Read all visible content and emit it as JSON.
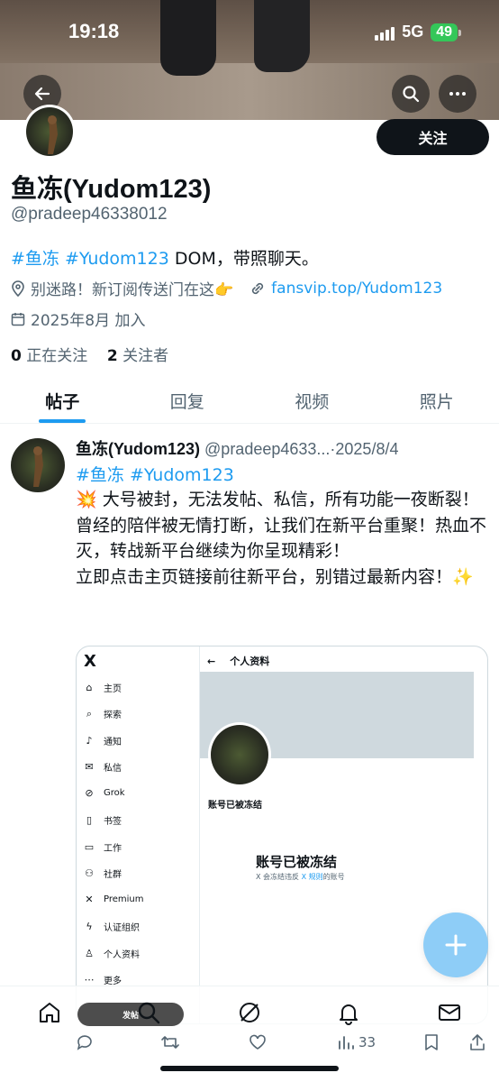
{
  "status": {
    "time": "19:18",
    "network": "5G",
    "battery": "49"
  },
  "profile": {
    "display_name": "鱼冻(Yudom123)",
    "handle": "@pradeep46338012",
    "follow_label": "关注",
    "bio_tag1": "#鱼冻",
    "bio_tag2": "#Yudom123",
    "bio_text": " DOM，带照聊天。",
    "location": "别迷路！新订阅传送门在这👉",
    "website": "fansvip.top/Yudom123",
    "joined": "2025年8月 加入",
    "following_count": "0",
    "following_label": "正在关注",
    "followers_count": "2",
    "followers_label": "关注者"
  },
  "tabs": [
    {
      "label": "帖子"
    },
    {
      "label": "回复"
    },
    {
      "label": "视频"
    },
    {
      "label": "照片"
    }
  ],
  "post": {
    "name": "鱼冻(Yudom123)",
    "meta": " @pradeep4633...·2025/8/4",
    "tags": "#鱼冻 #Yudom123",
    "lines": [
      "💥 大号被封，无法发帖、私信，所有功能一夜断裂！",
      "曾经的陪伴被无情打断，让我们在新平台重聚！热血不灭，转战新平台继续为你呈现精彩！",
      "立即点击主页链接前往新平台，别错过最新内容！✨"
    ],
    "views": "33"
  },
  "card": {
    "logo": "X",
    "topbar_title": "个人资料",
    "nav": [
      {
        "icon": "home-icon",
        "label": "主页"
      },
      {
        "icon": "search-icon",
        "label": "探索"
      },
      {
        "icon": "bell-icon",
        "label": "通知"
      },
      {
        "icon": "mail-icon",
        "label": "私信"
      },
      {
        "icon": "grok-icon",
        "label": "Grok"
      },
      {
        "icon": "bookmark-icon",
        "label": "书签"
      },
      {
        "icon": "briefcase-icon",
        "label": "工作"
      },
      {
        "icon": "people-icon",
        "label": "社群"
      },
      {
        "icon": "x-icon",
        "label": "Premium"
      },
      {
        "icon": "bolt-icon",
        "label": "认证组织"
      },
      {
        "icon": "person-icon",
        "label": "个人资料"
      },
      {
        "icon": "more-icon",
        "label": "更多"
      }
    ],
    "frozen_small": "账号已被冻结",
    "frozen_big": "账号已被冻结",
    "frozen_sub_a": "X 会冻结违反 ",
    "frozen_sub_link": "X 规则",
    "frozen_sub_b": "的账号",
    "post_pill": "发帖"
  }
}
